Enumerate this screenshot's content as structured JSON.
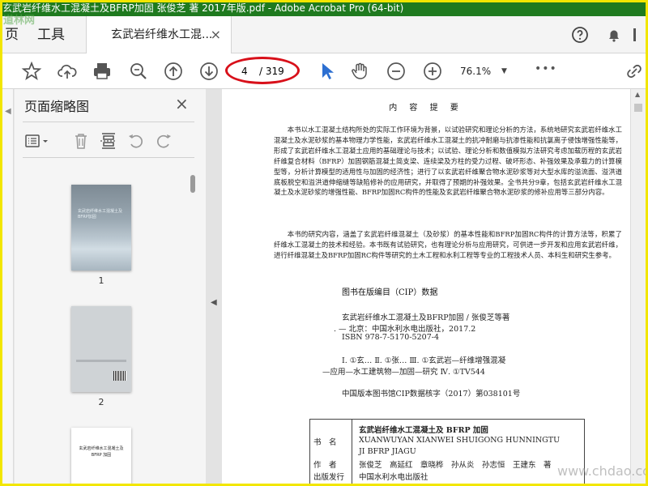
{
  "window": {
    "title": "玄武岩纤维水工混凝土及BFRP加固 张俊芝 著 2017年版.pdf - Adobe Acrobat Pro (64-bit)"
  },
  "menubar": {
    "home_label": "页",
    "tools_label": "工具",
    "document_tab": {
      "label": "玄武岩纤维水工混...",
      "close": "×"
    },
    "icons": [
      "help-icon",
      "bell-icon",
      "menu-icon"
    ]
  },
  "toolbar": {
    "icons": [
      "star-icon",
      "cloud-upload-icon",
      "print-icon",
      "zoom-search-icon",
      "page-up-icon",
      "page-down-icon",
      "select-arrow-icon",
      "hand-tool-icon",
      "zoom-out-icon",
      "zoom-in-icon",
      "more-icon",
      "share-link-icon"
    ],
    "page_current": "4",
    "page_total": "/ 319",
    "zoom_value": "76.1%",
    "more_label": "•••"
  },
  "colors": {
    "title_bar": "#1f7a1f",
    "annotation": "#d8101a",
    "frame": "#f2e600",
    "select_tool": "#2c6fd1"
  },
  "thumbnail_panel": {
    "title": "页面缩略图",
    "close": "×",
    "tool_icons": [
      "options-icon",
      "trash-icon",
      "insert-page-icon",
      "rotate-ccw-icon",
      "rotate-cw-icon"
    ],
    "pages": [
      {
        "number": "1",
        "cover_title": "玄武岩纤维水工混凝土及BFRP加固"
      },
      {
        "number": "2"
      },
      {
        "cover_title": "玄武岩纤维水工混凝土及 BFRP 加固"
      }
    ]
  },
  "document": {
    "heading": "内 容 提 要",
    "paragraphs": [
      "本书以水工混凝土结构所处的实际工作环境为背景，以试验研究和理论分析的方法，系统地研究玄武岩纤维水工混凝土及水泥砂浆的基本物理力学性能，玄武岩纤维水工混凝土的抗冲耐磨与抗渗性能和抗氯离子侵蚀增强性能等，形成了玄武岩纤维水工混凝土应用的基础理论与技术；以试验、理论分析和数值模拟方法研究考虑加载历程的玄武岩纤维复合材料（BFRP）加固钢筋混凝土简支梁、连续梁及方柱的受力过程、破坏形态、补强效果及承载力的计算模型等，分析计算模型的适用性与加固的经济性；进行了以玄武岩纤维聚合物水泥砂浆等对大型水库的溢流面、溢洪道底板脱空和溢洪道伸缩缝等缺陷修补的应用研究，并取得了预期的补强效果。全书共分9章，包括玄武岩纤维水工混凝土及水泥砂浆的增强性能、BFRP加固RC构件的性能及玄武岩纤维聚合物水泥砂浆的修补应用等三部分内容。",
      "本书的研究内容，涵盖了玄武岩纤维混凝土（及砂浆）的基本性能和BFRP加固RC构件的计算方法等，积累了纤维水工混凝土的技术和经验。本书既有试验研究，也有理论分析与应用研究，可供进一步开发和应用玄武岩纤维，进行纤维混凝土及BFRP加固RC构件等研究的土木工程和水利工程等专业的工程技术人员、本科生和研究生参考。"
    ],
    "cip": {
      "title": "图书在版编目（CIP）数据",
      "lines": [
        "玄武岩纤维水工混凝土及BFRP加固 / 张俊芝等著",
        ". — 北京：中国水利水电出版社，2017.2",
        "ISBN 978-7-5170-5207-4",
        "Ⅰ. ①玄…  Ⅱ. ①张…  Ⅲ. ①玄武岩—纤维增强混凝",
        "—应用—水工建筑物—加固—研究  Ⅳ. ①TV544",
        "中国版本图书馆CIP数据核字（2017）第038101号"
      ]
    },
    "info_table": {
      "book_label": "书　名",
      "book_title_cn": "玄武岩纤维水工混凝土及 BFRP 加固",
      "book_title_pinyin_1": "XUANWUYAN XIANWEI SHUIGONG HUNNINGTU",
      "book_title_pinyin_2": "JI BFRP JIAGU",
      "author_label": "作　者",
      "authors": "张俊芝　高延红　章晓桦　孙从炎　孙志恒　王建东　著",
      "publisher_label": "出版发行",
      "publisher": "中国水利水电出版社"
    }
  },
  "watermarks": {
    "top": "道林网",
    "bottom": "www.chdao.com"
  }
}
